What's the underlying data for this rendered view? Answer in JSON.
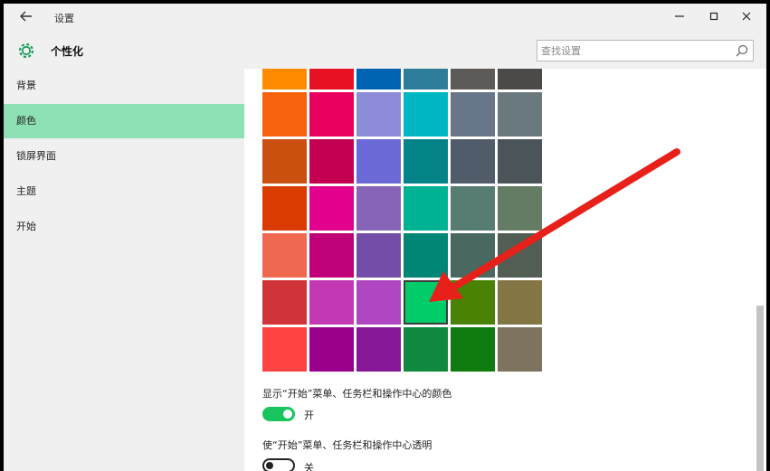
{
  "window": {
    "title": "设置",
    "back_icon": "back-arrow-icon",
    "controls": {
      "minimize": "—",
      "maximize": "▫",
      "close": "✕"
    }
  },
  "header": {
    "title": "个性化",
    "icon": "gear-icon",
    "search_placeholder": "查找设置"
  },
  "sidebar": {
    "items": [
      {
        "label": "背景",
        "active": false
      },
      {
        "label": "颜色",
        "active": true
      },
      {
        "label": "锁屏界面",
        "active": false
      },
      {
        "label": "主题",
        "active": false
      },
      {
        "label": "开始",
        "active": false
      }
    ],
    "active_color": "#8ee0b5"
  },
  "colors": {
    "rows": [
      [
        "#ff8c00",
        "#e81123",
        "#0063b1",
        "#2d7d9a",
        "#5d5a58",
        "#4c4a48"
      ],
      [
        "#f7630c",
        "#ea005e",
        "#8e8cd8",
        "#00b7c3",
        "#68768a",
        "#69797e"
      ],
      [
        "#ca5010",
        "#c30052",
        "#6b69d6",
        "#038387",
        "#515c6b",
        "#4a5459"
      ],
      [
        "#da3b01",
        "#e3008c",
        "#8764b8",
        "#00b294",
        "#567c73",
        "#647c64"
      ],
      [
        "#ef6950",
        "#bf0077",
        "#744da9",
        "#018574",
        "#486860",
        "#525e54"
      ],
      [
        "#d13438",
        "#c239b3",
        "#b146c2",
        "#00cc6a",
        "#498205",
        "#847545"
      ],
      [
        "#ff4343",
        "#9a0089",
        "#881798",
        "#10893e",
        "#107c10",
        "#7e735f"
      ]
    ],
    "selected": {
      "row": 5,
      "col": 3
    }
  },
  "options": {
    "show_color_label": "显示“开始”菜单、任务栏和操作中心的颜色",
    "show_color_state": "开",
    "show_color_on": true,
    "transparent_label": "使“开始”菜单、任务栏和操作中心透明",
    "transparent_state": "关",
    "transparent_on": false
  },
  "accent": "#18c45e",
  "annotation_color": "#e8201a"
}
